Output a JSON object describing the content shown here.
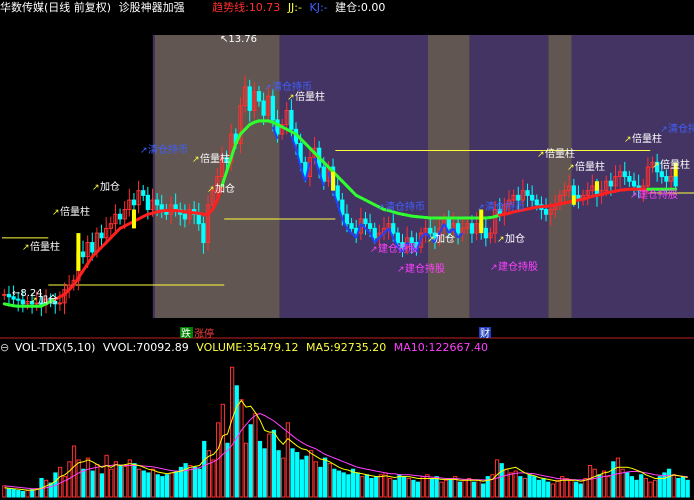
{
  "header": {
    "stock_name": "华数传媒",
    "period_label": "(日线 前复权)",
    "indicator_name": "诊股神器加强",
    "trend_line_label": "趋势线:",
    "trend_line_value": "10.73",
    "jj_label": "JJ:",
    "jj_value": "-",
    "kj_label": "KJ:",
    "kj_value": "-",
    "position_label": "建仓:",
    "position_value": "0.00"
  },
  "volume_header": {
    "indicator": "VOL-TDX(5,10)",
    "vvol_label": "VVOL:",
    "vvol_value": "70092.89",
    "volume_label": "VOLUME:",
    "volume_value": "35479.12",
    "ma5_label": "MA5:",
    "ma5_value": "92735.20",
    "ma10_label": "MA10:",
    "ma10_value": "122667.40"
  },
  "markers": {
    "high_price": "13.76",
    "low_price": "8.24",
    "tag_drop": "跌",
    "tag_rise": "涨停",
    "tag_finance": "财"
  },
  "signals": [
    {
      "label": "倍量柱"
    },
    {
      "label": "倍量柱"
    },
    {
      "label": "倍量柱"
    },
    {
      "label": "倍量柱"
    },
    {
      "label": "倍量柱"
    },
    {
      "label": "倍量柱"
    },
    {
      "label": "倍量柱"
    },
    {
      "label": "倍量柱"
    },
    {
      "label": "加仓"
    },
    {
      "label": "加仓"
    },
    {
      "label": "加仓"
    },
    {
      "label": "加仓"
    },
    {
      "label": "加仓"
    },
    {
      "label": "清仓持币"
    },
    {
      "label": "清仓持币"
    },
    {
      "label": "清仓持币"
    },
    {
      "label": "清仓持币"
    },
    {
      "label": "清仓持币"
    },
    {
      "label": "建仓持股"
    },
    {
      "label": "建仓持股"
    },
    {
      "label": "建仓持股"
    },
    {
      "label": "建仓持股"
    }
  ],
  "colors": {
    "bg": "#000000",
    "band": "#4a3a6e",
    "band_alt": "#6b5f5a",
    "up": "#ff3030",
    "down": "#00ffff",
    "trend_up": "#ff2020",
    "trend_mid": "#30ff30",
    "trend_down": "#2040ff",
    "signal_text": "#ffff40",
    "buy_text": "#ff40ff",
    "clear_text": "#4060ff",
    "ma5": "#ffff00",
    "ma10": "#ff40ff"
  },
  "chart_data": [
    {
      "type": "candlestick",
      "ylim": [
        8.0,
        14.0
      ],
      "high_label": 13.76,
      "low_label": 8.24,
      "close": [
        8.5,
        8.45,
        8.4,
        8.38,
        8.3,
        8.35,
        8.3,
        8.32,
        8.28,
        8.4,
        8.35,
        8.3,
        8.32,
        8.6,
        8.7,
        8.8,
        9.4,
        9.3,
        9.6,
        9.4,
        9.8,
        9.7,
        9.9,
        10.0,
        10.2,
        10.1,
        10.3,
        10.5,
        10.4,
        10.7,
        10.6,
        10.3,
        10.5,
        10.4,
        10.3,
        10.2,
        10.4,
        10.3,
        10.2,
        10.1,
        10.3,
        10.2,
        10.0,
        9.6,
        10.4,
        10.7,
        11.0,
        11.4,
        11.3,
        11.9,
        11.7,
        12.5,
        12.9,
        12.4,
        12.8,
        12.6,
        12.3,
        12.7,
        12.2,
        11.9,
        12.1,
        12.4,
        12.0,
        11.7,
        11.3,
        11.0,
        11.4,
        11.6,
        11.2,
        10.9,
        11.2,
        10.8,
        10.5,
        10.2,
        10.0,
        9.9,
        9.8,
        10.1,
        10.0,
        9.9,
        9.7,
        9.8,
        9.9,
        10.0,
        9.8,
        9.6,
        9.5,
        9.7,
        9.6,
        9.5,
        9.8,
        9.9,
        9.8,
        9.7,
        9.9,
        10.1,
        9.9,
        10.0,
        9.8,
        9.9,
        10.0,
        9.8,
        10.0,
        9.9,
        9.7,
        9.8,
        10.3,
        10.2,
        10.4,
        10.5,
        10.6,
        10.5,
        10.7,
        10.6,
        10.5,
        10.4,
        10.3,
        10.2,
        10.3,
        10.4,
        10.6,
        10.7,
        10.8,
        10.6,
        10.5,
        10.6,
        10.7,
        10.8,
        10.6,
        10.7,
        10.9,
        10.8,
        11.0,
        11.1,
        11.0,
        10.9,
        10.8,
        10.7,
        10.8,
        11.2,
        11.3,
        11.1,
        11.0,
        10.9,
        11.0,
        10.8
      ],
      "trend": [
        8.3,
        8.28,
        8.26,
        8.25,
        8.25,
        8.25,
        8.25,
        8.25,
        8.25,
        8.3,
        8.35,
        8.4,
        8.45,
        8.5,
        8.6,
        8.7,
        8.85,
        9.0,
        9.15,
        9.3,
        9.4,
        9.5,
        9.6,
        9.7,
        9.8,
        9.9,
        9.95,
        10.0,
        10.05,
        10.1,
        10.15,
        10.2,
        10.22,
        10.25,
        10.27,
        10.28,
        10.28,
        10.28,
        10.27,
        10.25,
        10.24,
        10.23,
        10.22,
        10.2,
        10.2,
        10.3,
        10.5,
        10.8,
        11.1,
        11.4,
        11.7,
        11.9,
        12.0,
        12.1,
        12.15,
        12.18,
        12.18,
        12.18,
        12.15,
        12.1,
        12.05,
        12.0,
        11.95,
        11.9,
        11.8,
        11.7,
        11.6,
        11.5,
        11.4,
        11.3,
        11.2,
        11.1,
        11.0,
        10.9,
        10.8,
        10.7,
        10.6,
        10.55,
        10.5,
        10.45,
        10.4,
        10.35,
        10.3,
        10.28,
        10.25,
        10.22,
        10.2,
        10.18,
        10.16,
        10.15,
        10.14,
        10.13,
        10.12,
        10.12,
        10.12,
        10.12,
        10.12,
        10.12,
        10.12,
        10.12,
        10.12,
        10.12,
        10.12,
        10.12,
        10.12,
        10.13,
        10.15,
        10.18,
        10.2,
        10.22,
        10.25,
        10.27,
        10.29,
        10.31,
        10.33,
        10.35,
        10.36,
        10.37,
        10.38,
        10.4,
        10.42,
        10.44,
        10.46,
        10.48,
        10.5,
        10.52,
        10.55,
        10.58,
        10.6,
        10.62,
        10.65,
        10.67,
        10.69,
        10.71,
        10.72,
        10.73,
        10.73,
        10.73,
        10.73,
        10.73,
        10.73,
        10.73,
        10.73,
        10.73,
        10.73,
        10.73
      ]
    },
    {
      "type": "bar",
      "title": "VOL-TDX(5,10)",
      "ylim": [
        0,
        150000
      ],
      "values": [
        12000,
        9000,
        8000,
        7000,
        6000,
        7000,
        8000,
        9000,
        20000,
        18000,
        15000,
        26000,
        32000,
        22000,
        38000,
        55000,
        40000,
        30000,
        42000,
        28000,
        35000,
        25000,
        45000,
        30000,
        38000,
        34000,
        33000,
        40000,
        36000,
        30000,
        28000,
        26000,
        30000,
        24000,
        22000,
        24000,
        26000,
        28000,
        32000,
        36000,
        34000,
        32000,
        30000,
        60000,
        50000,
        40000,
        80000,
        100000,
        58000,
        140000,
        120000,
        105000,
        58000,
        78000,
        90000,
        60000,
        52000,
        68000,
        72000,
        50000,
        42000,
        80000,
        52000,
        48000,
        40000,
        44000,
        50000,
        38000,
        32000,
        42000,
        36000,
        30000,
        28000,
        26000,
        24000,
        30000,
        26000,
        22000,
        24000,
        20000,
        22000,
        24000,
        26000,
        20000,
        18000,
        24000,
        22000,
        20000,
        18000,
        16000,
        22000,
        24000,
        20000,
        22000,
        16000,
        18000,
        20000,
        22000,
        16000,
        18000,
        20000,
        16000,
        18000,
        14000,
        22000,
        24000,
        40000,
        36000,
        30000,
        26000,
        28000,
        22000,
        20000,
        24000,
        22000,
        18000,
        20000,
        16000,
        14000,
        18000,
        22000,
        20000,
        18000,
        16000,
        14000,
        20000,
        34000,
        30000,
        24000,
        28000,
        22000,
        38000,
        42000,
        30000,
        26000,
        22000,
        18000,
        24000,
        20000,
        16000,
        18000,
        22000,
        26000,
        30000,
        24000,
        20000,
        22000,
        18000
      ],
      "ma5": [
        10000,
        9500,
        9000,
        8500,
        8000,
        7500,
        7500,
        8000,
        9500,
        12000,
        14000,
        17000,
        22000,
        24000,
        28000,
        33000,
        37000,
        38000,
        40000,
        38000,
        35000,
        32000,
        34000,
        32000,
        35000,
        34000,
        35000,
        36000,
        35000,
        34000,
        32000,
        30000,
        29000,
        27000,
        26000,
        25000,
        26000,
        27000,
        28000,
        30000,
        32000,
        33000,
        34000,
        40000,
        44000,
        46000,
        52000,
        66000,
        68000,
        84000,
        98000,
        104000,
        97000,
        98000,
        91000,
        83000,
        72000,
        70000,
        70000,
        62000,
        57000,
        63000,
        59000,
        55000,
        52000,
        51000,
        47000,
        44000,
        41000,
        40000,
        38000,
        35000,
        32000,
        30000,
        29000,
        27000,
        26000,
        25000,
        24000,
        23000,
        22000,
        22000,
        23000,
        22000,
        21000,
        22000,
        22000,
        22000,
        21000,
        20000,
        20000,
        20000,
        20000,
        20000,
        19000,
        19000,
        19000,
        19000,
        18000,
        18000,
        18000,
        18000,
        18000,
        17000,
        18000,
        19000,
        24000,
        28000,
        30000,
        31000,
        32000,
        29000,
        26000,
        24000,
        23000,
        21000,
        20000,
        19000,
        18000,
        17000,
        18000,
        18000,
        18000,
        18000,
        17000,
        18000,
        20000,
        22000,
        24000,
        26000,
        27000,
        30000,
        32000,
        32000,
        32000,
        31000,
        29000,
        27000,
        24000,
        22000,
        20000,
        20000,
        20000,
        22000,
        24000,
        23000,
        22000,
        21000
      ],
      "ma10": [
        12000,
        11500,
        11000,
        10500,
        10000,
        9500,
        9000,
        8800,
        9000,
        10000,
        11000,
        12500,
        15000,
        17500,
        20000,
        23000,
        26000,
        28000,
        30000,
        31000,
        32000,
        33000,
        34000,
        34000,
        35000,
        34500,
        34000,
        34000,
        34000,
        34000,
        33500,
        33000,
        32500,
        31500,
        30500,
        29500,
        28500,
        28000,
        28000,
        28500,
        29500,
        30500,
        31500,
        34000,
        36000,
        38000,
        41000,
        46000,
        50000,
        56000,
        64000,
        72000,
        78000,
        84000,
        88000,
        90000,
        88000,
        85000,
        82000,
        78000,
        74000,
        70000,
        66000,
        62000,
        59000,
        56000,
        54000,
        52000,
        49000,
        46000,
        44000,
        42000,
        40000,
        38000,
        36000,
        34000,
        32000,
        31000,
        30000,
        29000,
        28000,
        27000,
        26000,
        25000,
        25000,
        24000,
        24000,
        24000,
        23500,
        23000,
        22500,
        22000,
        21500,
        21000,
        20500,
        20000,
        20000,
        20000,
        19500,
        19000,
        19000,
        18800,
        18600,
        18400,
        18500,
        19000,
        20500,
        22000,
        23500,
        24500,
        25500,
        26000,
        26000,
        25500,
        25000,
        24000,
        23000,
        22000,
        21000,
        20000,
        19500,
        19000,
        18800,
        18600,
        18400,
        18500,
        19000,
        20000,
        21000,
        22000,
        23000,
        24000,
        25000,
        26000,
        27000,
        27500,
        27500,
        27000,
        26000,
        25000,
        24000,
        23500,
        23000,
        23000,
        23500,
        23000,
        22500,
        22000
      ]
    }
  ]
}
